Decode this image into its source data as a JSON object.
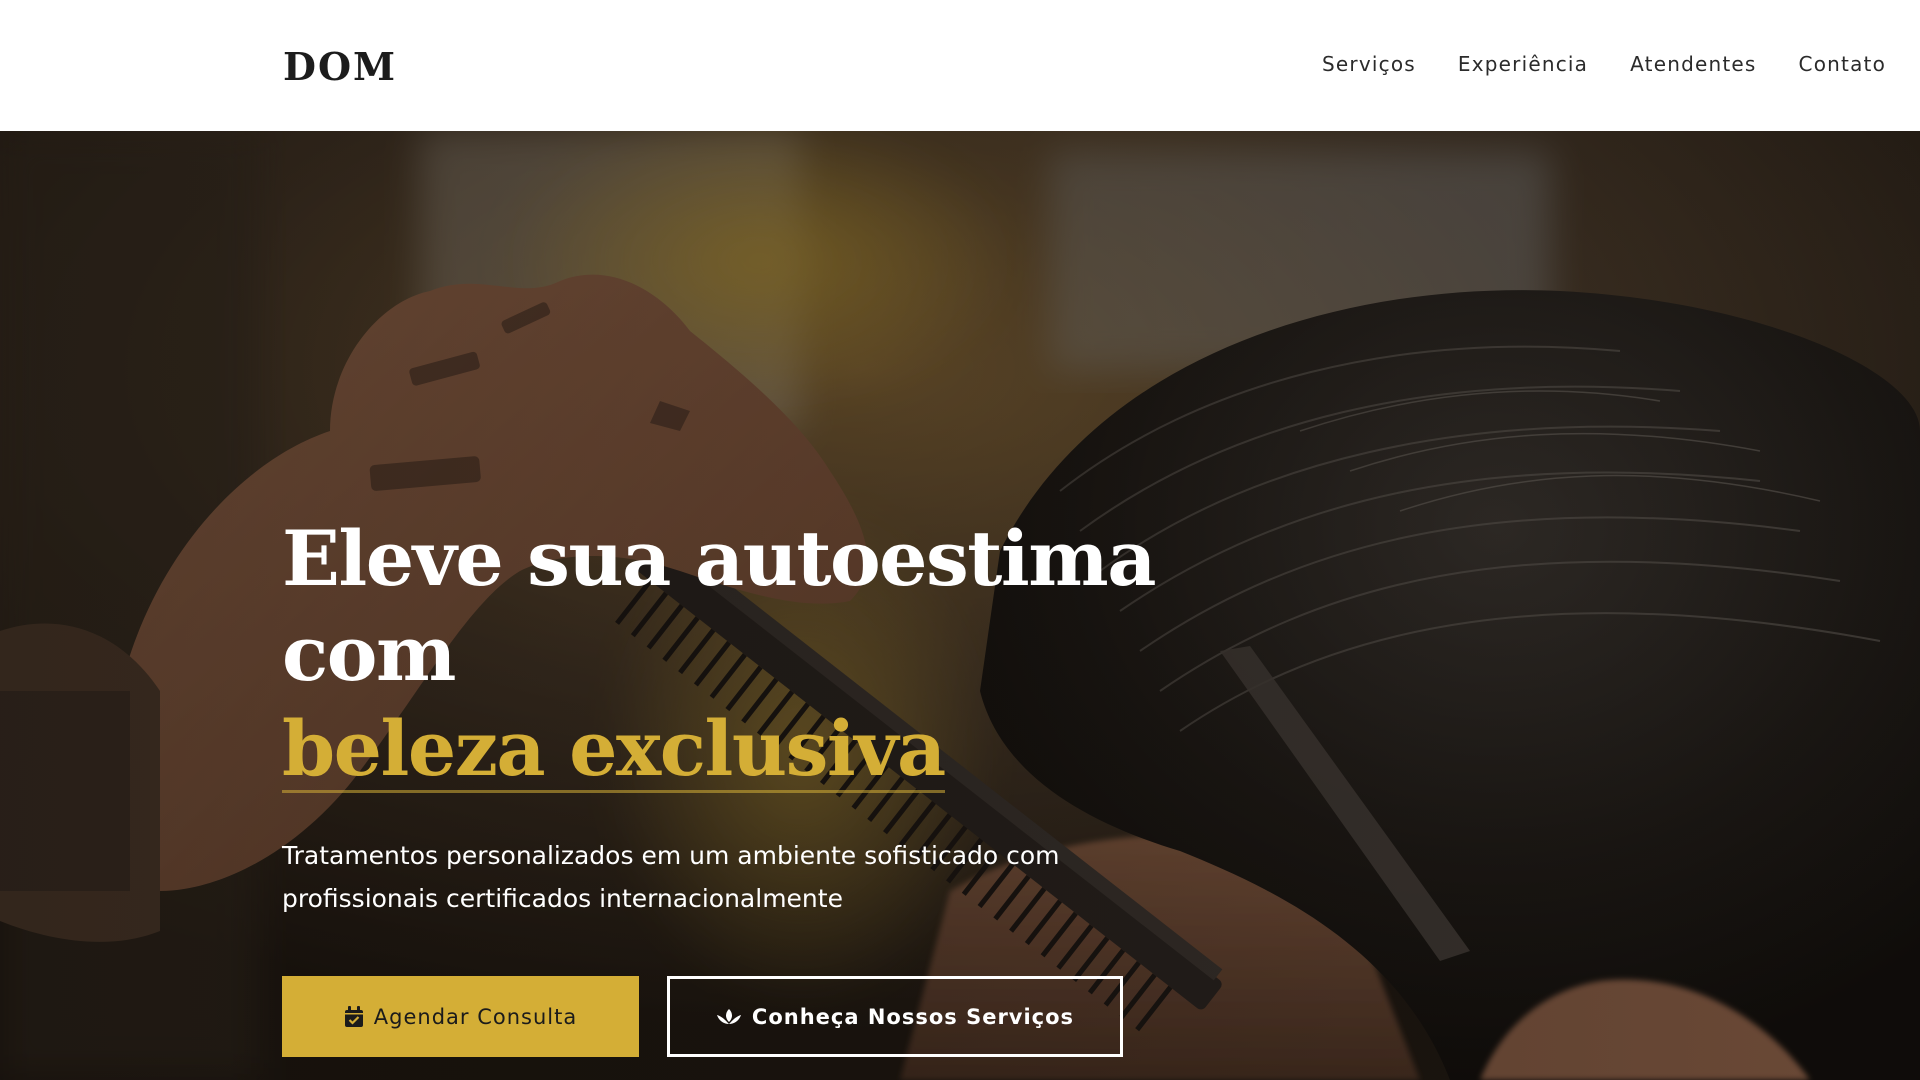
{
  "header": {
    "logo": "DOM",
    "nav": [
      {
        "label": "Serviços"
      },
      {
        "label": "Experiência"
      },
      {
        "label": "Atendentes"
      },
      {
        "label": "Contato"
      }
    ]
  },
  "hero": {
    "title_line1": "Eleve sua autoestima com",
    "title_highlight": "beleza exclusiva",
    "subtitle_line1": "Tratamentos personalizados em um ambiente sofisticado com",
    "subtitle_line2": "profissionais certificados internacionalmente",
    "primary_button": {
      "label": "Agendar Consulta",
      "icon": "calendar-check-icon"
    },
    "secondary_button": {
      "label": "Conheça Nossos Serviços",
      "icon": "spa-lotus-icon"
    },
    "background_image": "barber-combing-hair-photo"
  },
  "colors": {
    "accent": "#d4ae36",
    "header_bg": "#ffffff",
    "text_dark": "#1c1c1c"
  }
}
